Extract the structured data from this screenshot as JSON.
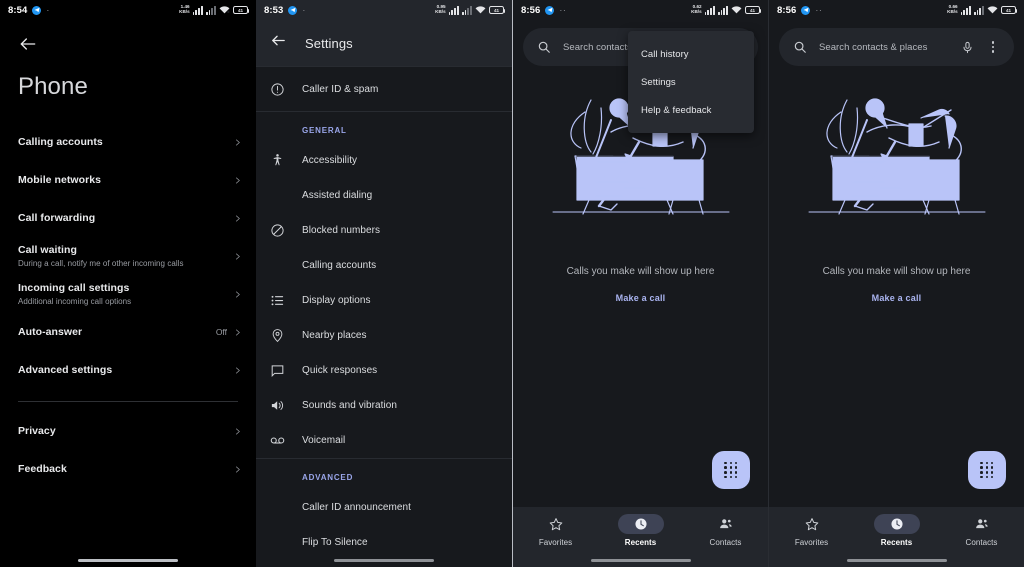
{
  "status_bar": {
    "p1": {
      "time": "8:54",
      "net_speed_value": "1.46",
      "net_speed_unit": "KB/s",
      "battery": "41"
    },
    "p2": {
      "time": "8:53",
      "net_speed_value": "0.95",
      "net_speed_unit": "KB/s",
      "battery": "41"
    },
    "p3": {
      "time": "8:56",
      "net_speed_value": "0.62",
      "net_speed_unit": "KB/s",
      "battery": "41"
    },
    "p4": {
      "time": "8:56",
      "net_speed_value": "0.66",
      "net_speed_unit": "KB/s",
      "battery": "41"
    }
  },
  "panel1": {
    "back_icon": "arrow-back-icon",
    "title": "Phone",
    "rows": [
      {
        "label": "Calling accounts",
        "sub": "",
        "value": ""
      },
      {
        "label": "Mobile networks",
        "sub": "",
        "value": ""
      },
      {
        "label": "Call forwarding",
        "sub": "",
        "value": ""
      },
      {
        "label": "Call waiting",
        "sub": "During a call, notify me of other incoming calls",
        "value": ""
      },
      {
        "label": "Incoming call settings",
        "sub": "Additional incoming call options",
        "value": ""
      },
      {
        "label": "Auto-answer",
        "sub": "",
        "value": "Off"
      },
      {
        "label": "Advanced settings",
        "sub": "",
        "value": ""
      }
    ],
    "rows_after_divider": [
      {
        "label": "Privacy",
        "sub": "",
        "value": ""
      },
      {
        "label": "Feedback",
        "sub": "",
        "value": ""
      }
    ]
  },
  "panel2": {
    "back_icon": "arrow-back-icon",
    "title": "Settings",
    "top_item": {
      "label": "Caller ID & spam",
      "icon": "info-circle-icon"
    },
    "general_header": "GENERAL",
    "general_items": [
      {
        "label": "Accessibility",
        "icon": "accessibility-icon"
      },
      {
        "label": "Assisted dialing",
        "icon": ""
      },
      {
        "label": "Blocked numbers",
        "icon": "block-icon"
      },
      {
        "label": "Calling accounts",
        "icon": ""
      },
      {
        "label": "Display options",
        "icon": "list-icon"
      },
      {
        "label": "Nearby places",
        "icon": "location-pin-icon"
      },
      {
        "label": "Quick responses",
        "icon": "chat-bubble-icon"
      },
      {
        "label": "Sounds and vibration",
        "icon": "volume-icon"
      },
      {
        "label": "Voicemail",
        "icon": "voicemail-icon"
      }
    ],
    "advanced_header": "ADVANCED",
    "advanced_items": [
      {
        "label": "Caller ID announcement",
        "icon": ""
      },
      {
        "label": "Flip To Silence",
        "icon": ""
      }
    ]
  },
  "panel3": {
    "search": {
      "icon": "search-icon",
      "placeholder": "Search contacts"
    },
    "overflow_menu": {
      "items": [
        {
          "label": "Call history"
        },
        {
          "label": "Settings"
        },
        {
          "label": "Help & feedback"
        }
      ]
    },
    "empty_state": {
      "illustration": "person-on-couch-with-dog-illustration",
      "message": "Calls you make will show up here",
      "cta": "Make a call"
    },
    "fab": {
      "icon": "dialpad-icon"
    },
    "bottom_nav": [
      {
        "label": "Favorites",
        "icon": "star-icon",
        "selected": false
      },
      {
        "label": "Recents",
        "icon": "clock-icon",
        "selected": true
      },
      {
        "label": "Contacts",
        "icon": "contacts-icon",
        "selected": false
      }
    ]
  },
  "panel4": {
    "search": {
      "icon": "search-icon",
      "placeholder": "Search contacts & places",
      "mic_icon": "microphone-icon",
      "overflow_icon": "kebab-menu-icon"
    },
    "empty_state": {
      "illustration": "person-on-couch-with-dog-illustration",
      "message": "Calls you make will show up here",
      "cta": "Make a call"
    },
    "fab": {
      "icon": "dialpad-icon"
    },
    "bottom_nav": [
      {
        "label": "Favorites",
        "icon": "star-icon",
        "selected": false
      },
      {
        "label": "Recents",
        "icon": "clock-icon",
        "selected": true
      },
      {
        "label": "Contacts",
        "icon": "contacts-icon",
        "selected": false
      }
    ]
  },
  "colors": {
    "panel_bg": "#17191d",
    "panel1_bg": "#000000",
    "appbar_bg": "#23262c",
    "accent_blue": "#9aa6ea",
    "illustration_blue": "#b9c4f8",
    "fab_bg": "#b9c4f8"
  }
}
